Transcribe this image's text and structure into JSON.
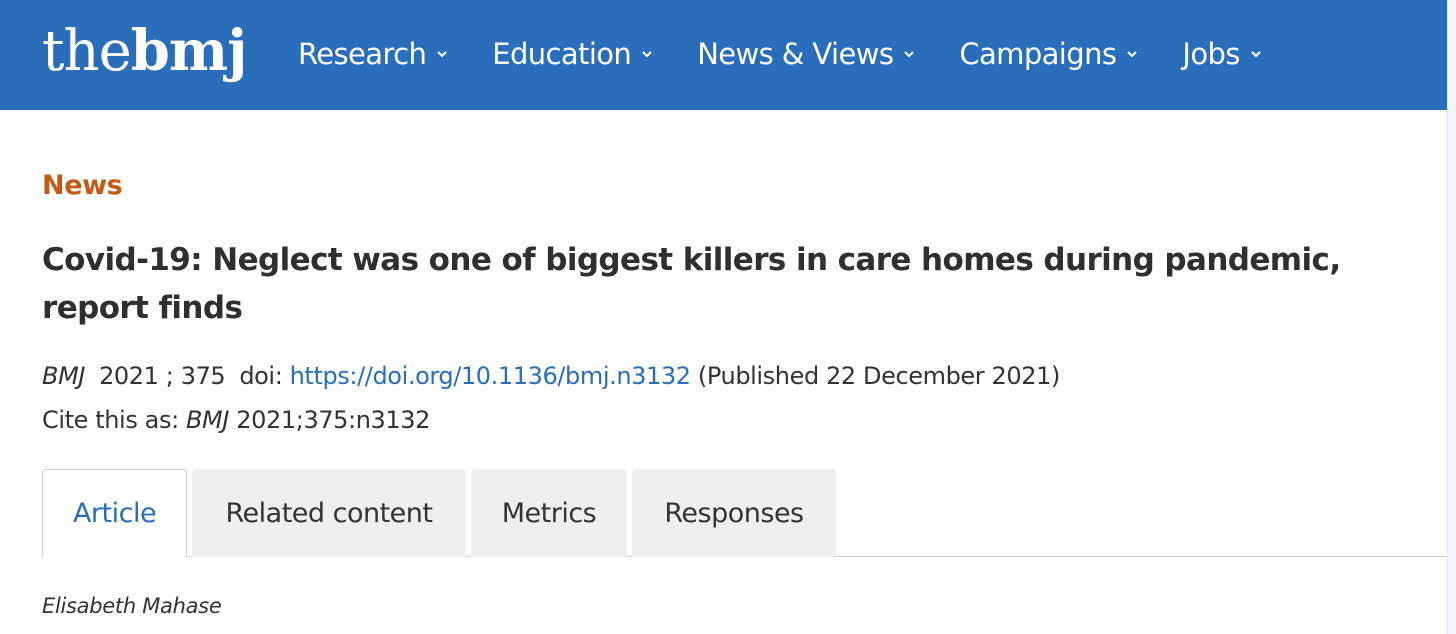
{
  "header": {
    "logo": {
      "prefix": "the",
      "bold": "bmj"
    },
    "nav": [
      {
        "label": "Research",
        "icon": "chevron-down-icon"
      },
      {
        "label": "Education",
        "icon": "chevron-down-icon"
      },
      {
        "label": "News & Views",
        "icon": "chevron-down-icon"
      },
      {
        "label": "Campaigns",
        "icon": "chevron-down-icon"
      },
      {
        "label": "Jobs",
        "icon": "chevron-down-icon"
      }
    ]
  },
  "article": {
    "section": "News",
    "title": "Covid-19: Neglect was one of biggest killers in care homes during pandemic, report finds",
    "citation": {
      "journal": "BMJ",
      "year": "2021",
      "volume": "; 375",
      "doi_label": "doi:",
      "doi_url": "https://doi.org/10.1136/bmj.n3132",
      "published": "(Published 22 December 2021)"
    },
    "cite_as": {
      "prefix": "Cite this as:",
      "journal": "BMJ",
      "ref": "2021;375:n3132"
    },
    "tabs": [
      {
        "label": "Article",
        "active": true
      },
      {
        "label": "Related content",
        "active": false
      },
      {
        "label": "Metrics",
        "active": false
      },
      {
        "label": "Responses",
        "active": false
      }
    ],
    "author": "Elisabeth Mahase"
  },
  "colors": {
    "brand_blue": "#2a6ebb",
    "section_orange": "#c45a15",
    "text": "#333333",
    "tab_bg": "#efefef"
  }
}
